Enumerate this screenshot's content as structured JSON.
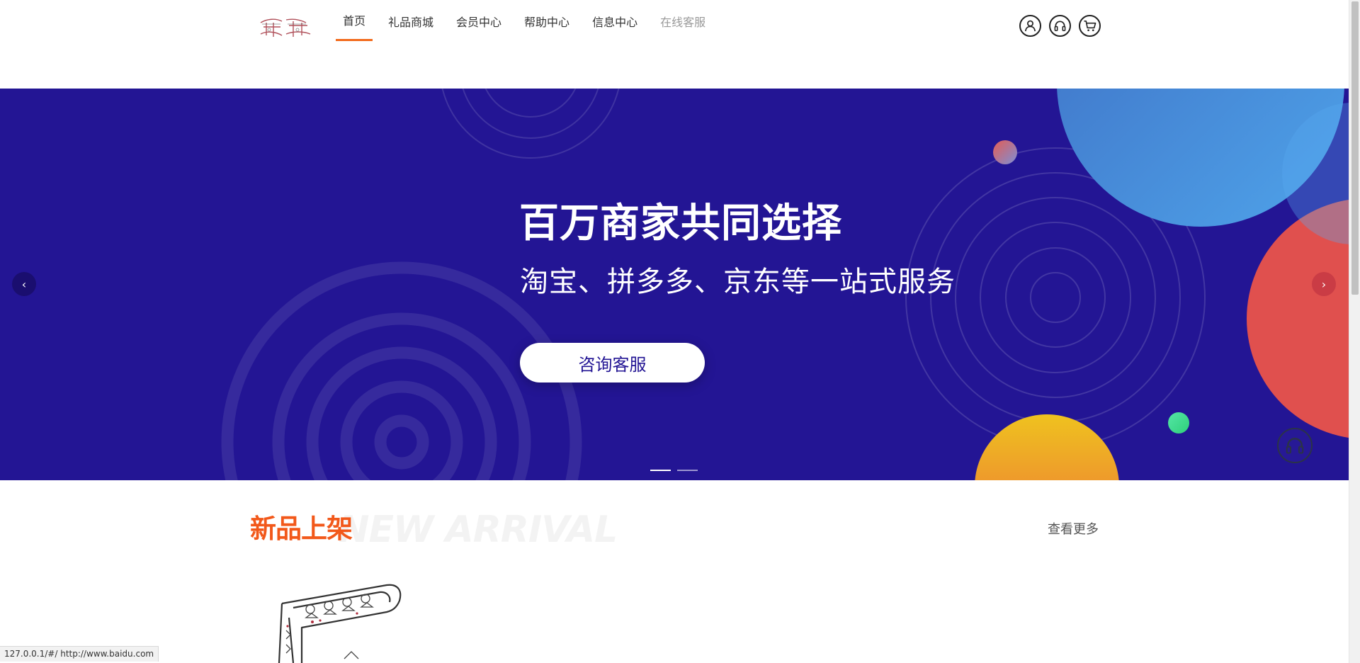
{
  "header": {
    "logo_name": "site-logo",
    "nav": [
      {
        "label": "首页",
        "active": true
      },
      {
        "label": "礼品商城"
      },
      {
        "label": "会员中心"
      },
      {
        "label": "帮助中心"
      },
      {
        "label": "信息中心"
      },
      {
        "label": "在线客服",
        "muted": true
      }
    ],
    "icons": [
      "user-icon",
      "headset-icon",
      "cart-icon"
    ]
  },
  "banner": {
    "title": "百万商家共同选择",
    "subtitle": "淘宝、拼多多、京东等一站式服务",
    "button": "咨询客服",
    "prev": "‹",
    "next": "›",
    "slides": 2,
    "active_slide": 1,
    "colors": {
      "background": "#231594",
      "accent_blue": "#4a9ee6",
      "accent_red": "#e0504e",
      "accent_orange": "#f2a42a",
      "accent_green": "#3ddc8e"
    }
  },
  "section": {
    "title": "新品上架",
    "title_en": "NEW ARRIVAL",
    "more": "查看更多"
  },
  "status_bar": {
    "url": "127.0.0.1/#/ http://www.baidu.com"
  },
  "colors": {
    "brand": "#f26a1b"
  }
}
